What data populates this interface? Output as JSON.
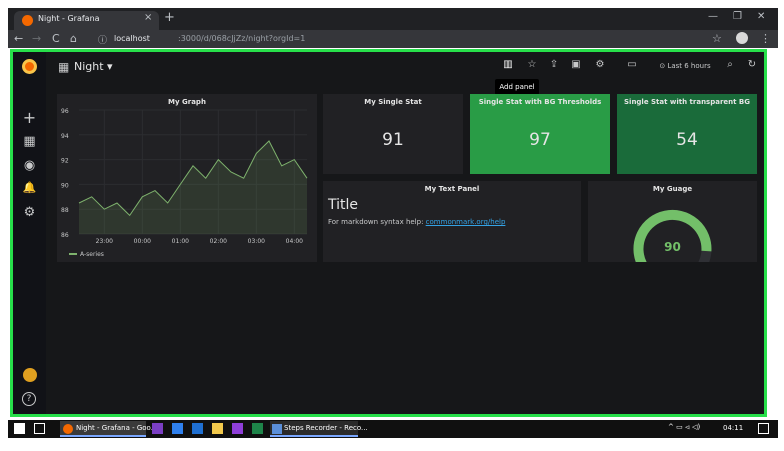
{
  "browser": {
    "tab_title": "Night - Grafana",
    "tab_close": "×",
    "new_tab": "+",
    "window_minimize": "—",
    "window_restore": "❐",
    "window_close": "✕",
    "nav_back": "←",
    "nav_forward": "→",
    "nav_reload": "C",
    "nav_home": "⌂",
    "url_info": "ⓘ",
    "url_host": "localhost",
    "url_path": ":3000/d/068cJjZz/night?orgId=1",
    "bookmark": "☆",
    "menu": "⋮"
  },
  "sidemenu": {
    "items": [
      {
        "icon": "+",
        "name": "create-icon"
      },
      {
        "icon": "▦",
        "name": "dashboards-icon"
      },
      {
        "icon": "◉",
        "name": "explore-icon"
      },
      {
        "icon": "🔔",
        "name": "alerting-icon"
      },
      {
        "icon": "⚙",
        "name": "configuration-icon"
      }
    ],
    "help": "?"
  },
  "topnav": {
    "dashboard_icon": "▦",
    "dashboard_title": "Night ▾",
    "add_panel_icon": "▥",
    "star_icon": "☆",
    "share_icon": "⇪",
    "save_icon": "▣",
    "settings_icon": "⚙",
    "tv_icon": "▭",
    "time_range": "⊙ Last 6 hours",
    "zoom_icon": "⌕",
    "refresh_icon": "↻",
    "tooltip": "Add panel"
  },
  "panels": {
    "graph": {
      "title": "My Graph",
      "legend": "A-series",
      "legend_color": "#7eb26d"
    },
    "single_stat": {
      "title": "My Single Stat",
      "value": "91"
    },
    "stat_bg": {
      "title": "Single Stat with BG Thresholds",
      "value": "97",
      "color": "#299c46"
    },
    "stat_transparent": {
      "title": "Single Stat with transparent BG",
      "value": "54",
      "color": "#1a6b3a"
    },
    "text": {
      "title": "My Text Panel",
      "heading": "Title",
      "body": "For markdown syntax help:",
      "link": "commonmark.org/help"
    },
    "gauge": {
      "title": "My Guage",
      "value": "90",
      "value_fraction": 0.9,
      "color": "#73bf69"
    }
  },
  "chart_data": {
    "type": "line",
    "title": "My Graph",
    "x": [
      "22:10",
      "22:40",
      "23:00",
      "23:20",
      "23:40",
      "00:00",
      "00:20",
      "00:40",
      "01:00",
      "01:20",
      "01:40",
      "02:00",
      "02:20",
      "02:40",
      "03:00",
      "03:20",
      "03:40",
      "04:00",
      "04:10"
    ],
    "series": [
      {
        "name": "A-series",
        "values": [
          88.5,
          89.0,
          88.0,
          88.5,
          87.5,
          89.0,
          89.5,
          88.5,
          90.0,
          91.5,
          90.5,
          92.0,
          91.0,
          90.5,
          92.5,
          93.5,
          91.5,
          92.0,
          90.5
        ]
      }
    ],
    "yticks": [
      "96",
      "94",
      "92",
      "90",
      "88",
      "86"
    ],
    "xticks": [
      "23:00",
      "00:00",
      "01:00",
      "02:00",
      "03:00",
      "04:00"
    ],
    "ylim": [
      86,
      96
    ],
    "grid": true,
    "legend": "bottom-left"
  },
  "taskbar": {
    "chrome_task": "Night - Grafana - Goo...",
    "steps_task": "Steps Recorder - Reco...",
    "tray": "^ ▭ ⏿ ◁)",
    "clock": "04:11"
  }
}
